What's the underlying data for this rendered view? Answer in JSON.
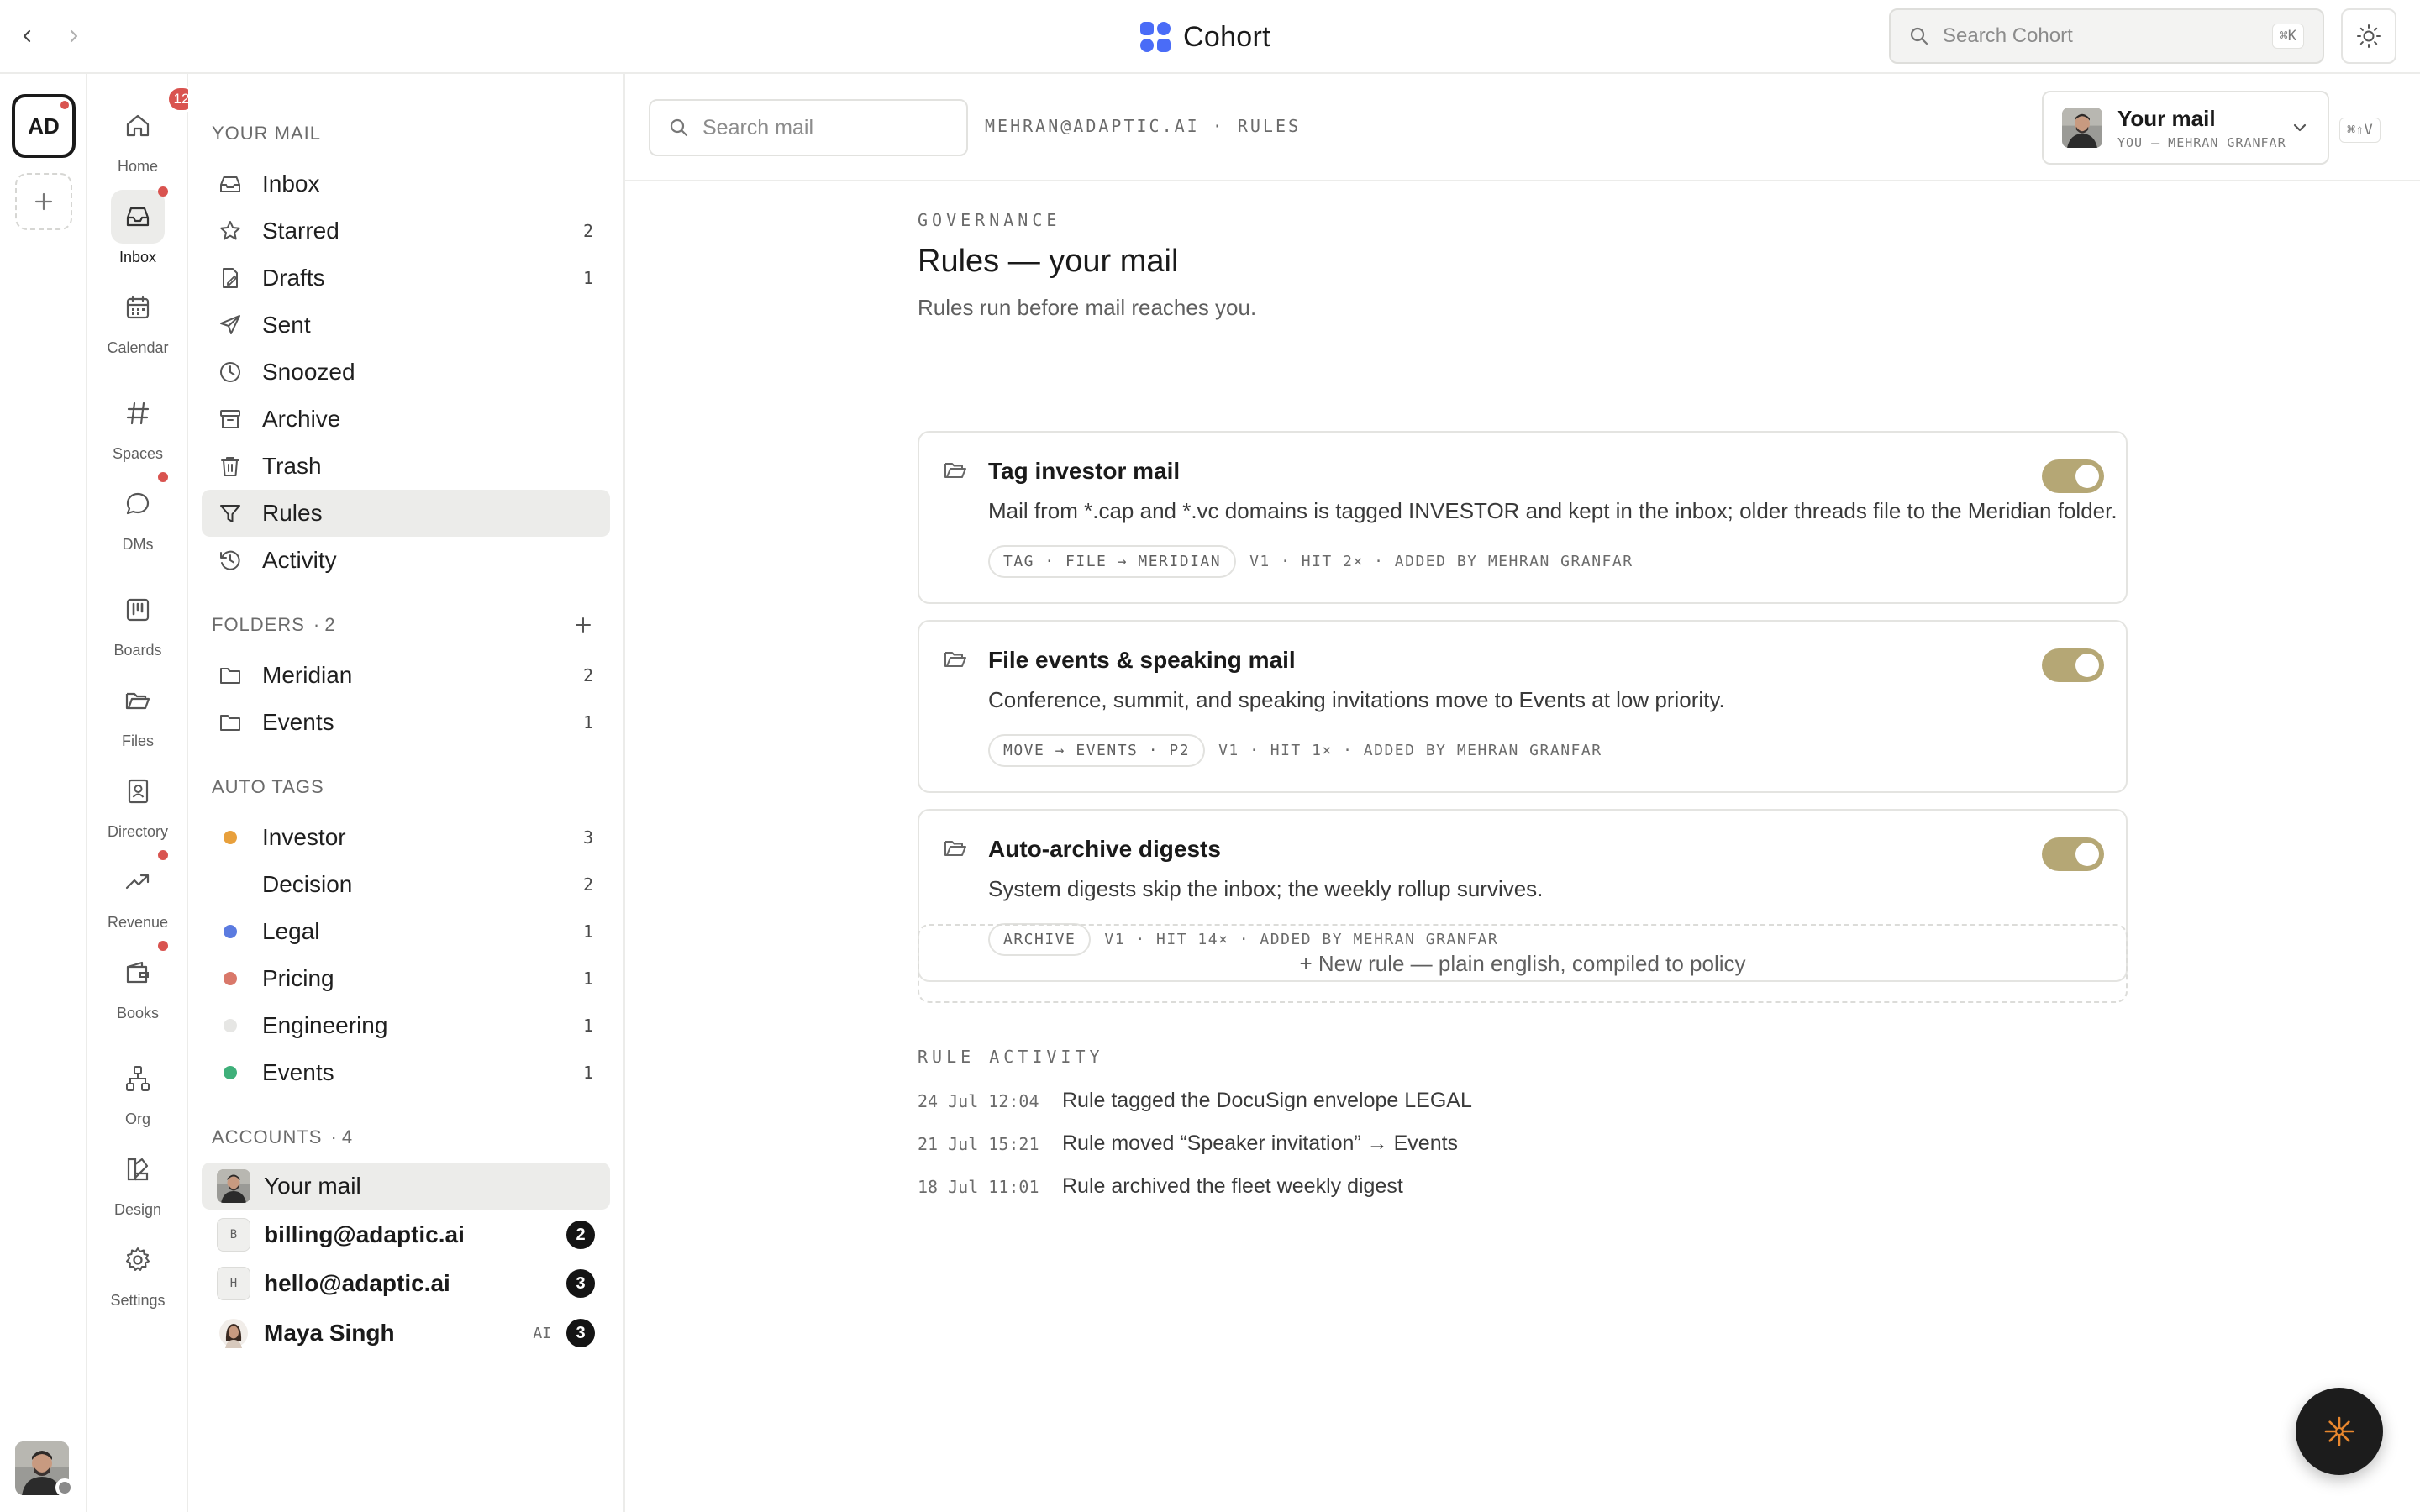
{
  "app": {
    "name": "Cohort"
  },
  "topbar": {
    "search_placeholder": "Search Cohort",
    "search_shortcut": "⌘K"
  },
  "workspace": {
    "initials": "AD"
  },
  "apps": [
    {
      "label": "Home",
      "icon": "home-icon",
      "badge": "12"
    },
    {
      "label": "Inbox",
      "icon": "inbox-icon",
      "active": true
    },
    {
      "label": "Calendar",
      "icon": "calendar-icon"
    },
    {
      "label": "Spaces",
      "icon": "hash-icon"
    },
    {
      "label": "DMs",
      "icon": "message-icon"
    },
    {
      "label": "Boards",
      "icon": "board-icon"
    },
    {
      "label": "Files",
      "icon": "folder-icon"
    },
    {
      "label": "Directory",
      "icon": "contact-book-icon"
    },
    {
      "label": "Revenue",
      "icon": "trending-up-icon"
    },
    {
      "label": "Books",
      "icon": "wallet-icon"
    },
    {
      "label": "Org",
      "icon": "org-chart-icon"
    },
    {
      "label": "Design",
      "icon": "design-icon"
    },
    {
      "label": "Settings",
      "icon": "gear-icon"
    }
  ],
  "sidebar": {
    "your_mail_label": "YOUR MAIL",
    "nav": [
      {
        "label": "Inbox",
        "count": ""
      },
      {
        "label": "Starred",
        "count": "2"
      },
      {
        "label": "Drafts",
        "count": "1"
      },
      {
        "label": "Sent",
        "count": ""
      },
      {
        "label": "Snoozed",
        "count": ""
      },
      {
        "label": "Archive",
        "count": ""
      },
      {
        "label": "Trash",
        "count": ""
      },
      {
        "label": "Rules",
        "count": ""
      },
      {
        "label": "Activity",
        "count": ""
      }
    ],
    "folders_label": "FOLDERS",
    "folders_count": "· 2",
    "folders": [
      {
        "label": "Meridian",
        "count": "2"
      },
      {
        "label": "Events",
        "count": "1"
      }
    ],
    "auto_tags_label": "AUTO TAGS",
    "tags": [
      {
        "label": "Investor",
        "count": "3",
        "color": "#e8a03c"
      },
      {
        "label": "Decision",
        "count": "2",
        "color": ""
      },
      {
        "label": "Legal",
        "count": "1",
        "color": "#5b7be0"
      },
      {
        "label": "Pricing",
        "count": "1",
        "color": "#d9786a"
      },
      {
        "label": "Engineering",
        "count": "1",
        "color": "#e6e6e4"
      },
      {
        "label": "Events",
        "count": "1",
        "color": "#3fb07a"
      }
    ],
    "accounts_label": "ACCOUNTS",
    "accounts_count": "· 4",
    "accounts": [
      {
        "name": "Your mail",
        "letter": "",
        "ai": "",
        "badge": ""
      },
      {
        "name": "billing@adaptic.ai",
        "letter": "B",
        "ai": "",
        "badge": "2"
      },
      {
        "name": "hello@adaptic.ai",
        "letter": "H",
        "ai": "",
        "badge": "3"
      },
      {
        "name": "Maya Singh",
        "letter": "",
        "ai": "AI",
        "badge": "3"
      }
    ]
  },
  "header": {
    "search_placeholder": "Search mail",
    "breadcrumb": "MEHRAN@ADAPTIC.AI · RULES",
    "account_title": "Your mail",
    "account_sub": "YOU — MEHRAN GRANFAR",
    "shortcut": "⌘⇧V"
  },
  "page": {
    "eyebrow": "GOVERNANCE",
    "title": "Rules — your mail",
    "subtitle": "Rules run before mail reaches you."
  },
  "rules": [
    {
      "title": "Tag investor mail",
      "description": "Mail from *.cap and *.vc domains is tagged INVESTOR and kept in the inbox; older threads file to the Meridian folder.",
      "chip": "TAG · FILE → MERIDIAN",
      "meta": "V1 · HIT 2× · ADDED BY MEHRAN GRANFAR",
      "enabled": true
    },
    {
      "title": "File events & speaking mail",
      "description": "Conference, summit, and speaking invitations move to Events at low priority.",
      "chip": "MOVE → EVENTS · P2",
      "meta": "V1 · HIT 1× · ADDED BY MEHRAN GRANFAR",
      "enabled": true
    },
    {
      "title": "Auto-archive digests",
      "description": "System digests skip the inbox; the weekly rollup survives.",
      "chip": "ARCHIVE",
      "meta": "V1 · HIT 14× · ADDED BY MEHRAN GRANFAR",
      "enabled": true
    }
  ],
  "new_rule_label": "+ New rule — plain english, compiled to policy",
  "activity": {
    "label": "RULE ACTIVITY",
    "items": [
      {
        "time": "24 Jul 12:04",
        "text": "Rule tagged the DocuSign envelope LEGAL"
      },
      {
        "time": "21 Jul 15:21",
        "text": "Rule moved “Speaker invitation” → Events"
      },
      {
        "time": "18 Jul 11:01",
        "text": "Rule archived the fleet weekly digest"
      }
    ]
  },
  "colors": {
    "accent_toggle": "#b5a775",
    "notification": "#d9534f",
    "brand_blue": "#4a6cf7"
  }
}
